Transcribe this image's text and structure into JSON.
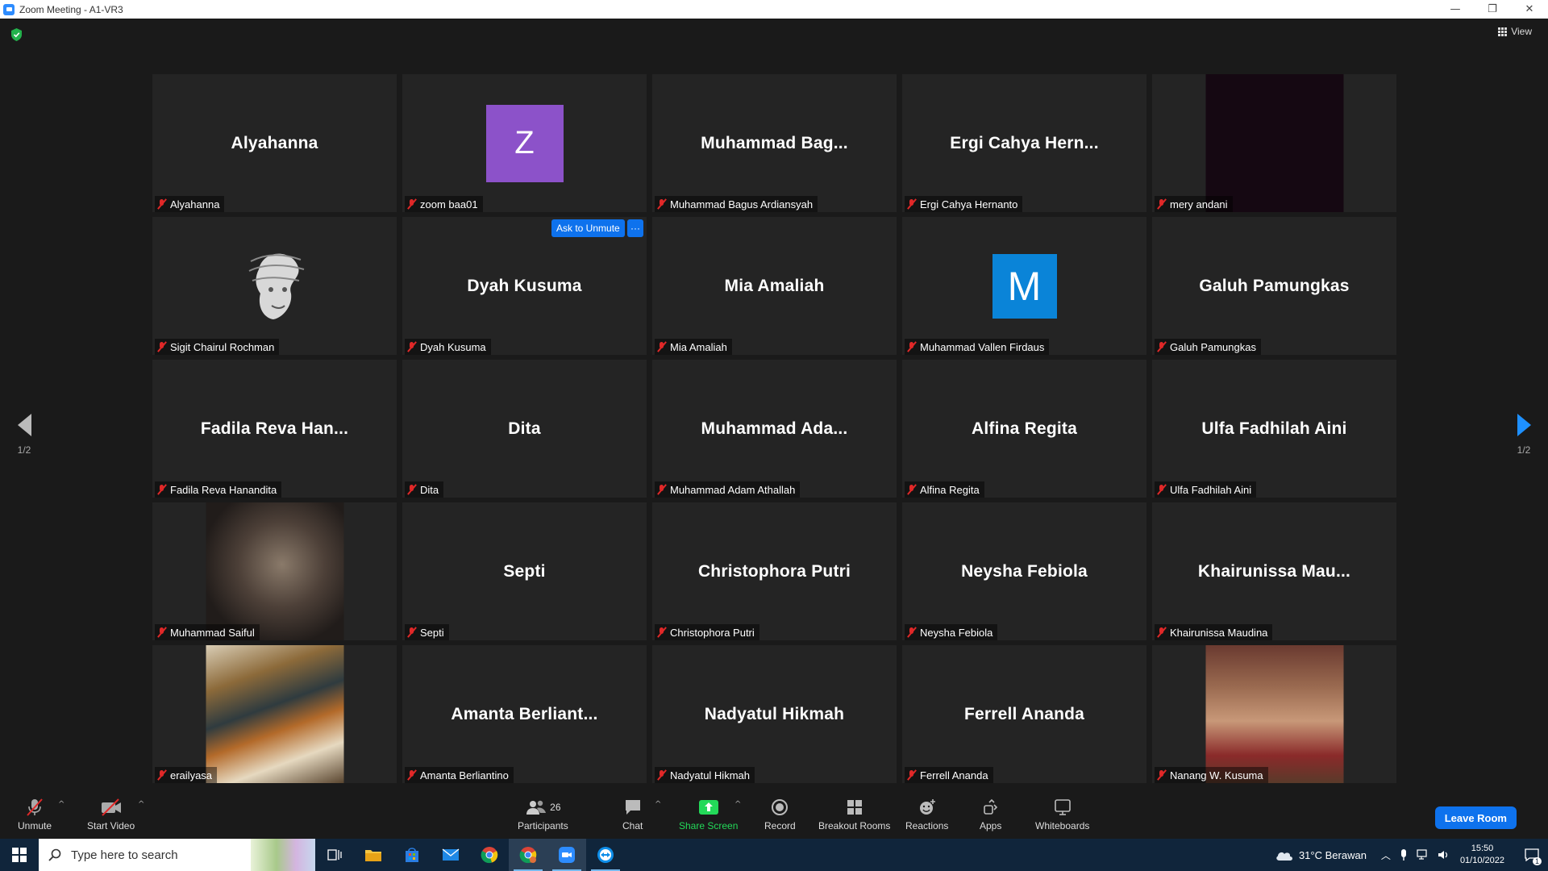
{
  "window": {
    "title": "Zoom Meeting - A1-VR3",
    "minimize": "—",
    "restore": "❐",
    "close": "✕"
  },
  "header": {
    "view_label": "View"
  },
  "tiles": [
    {
      "big": "Alyahanna",
      "label": "Alyahanna",
      "kind": "name"
    },
    {
      "big": "Z",
      "label": "zoom baa01",
      "kind": "letter",
      "color": "#8c52c9"
    },
    {
      "big": "Muhammad  Bag...",
      "label": "Muhammad Bagus Ardiansyah",
      "kind": "name"
    },
    {
      "big": "Ergi Cahya Hern...",
      "label": "Ergi Cahya Hernanto",
      "kind": "name"
    },
    {
      "big": "",
      "label": "mery andani",
      "kind": "dark-photo"
    },
    {
      "big": "",
      "label": "Sigit Chairul Rochman",
      "kind": "sketch"
    },
    {
      "big": "Dyah Kusuma",
      "label": "Dyah Kusuma",
      "kind": "name"
    },
    {
      "big": "Mia Amaliah",
      "label": "Mia Amaliah",
      "kind": "name"
    },
    {
      "big": "M",
      "label": "Muhammad Vallen Firdaus",
      "kind": "letter",
      "color": "#0a84d8"
    },
    {
      "big": "Galuh Pamungkas",
      "label": "Galuh Pamungkas",
      "kind": "name"
    },
    {
      "big": "Fadila Reva Han...",
      "label": "Fadila Reva Hanandita",
      "kind": "name"
    },
    {
      "big": "Dita",
      "label": "Dita",
      "kind": "name"
    },
    {
      "big": "Muhammad  Ada...",
      "label": "Muhammad Adam Athallah",
      "kind": "name"
    },
    {
      "big": "Alfina Regita",
      "label": "Alfina Regita",
      "kind": "name"
    },
    {
      "big": "Ulfa Fadhilah Aini",
      "label": "Ulfa Fadhilah Aini",
      "kind": "name"
    },
    {
      "big": "",
      "label": "Muhammad Saiful",
      "kind": "portrait-photo"
    },
    {
      "big": "Septi",
      "label": "Septi",
      "kind": "name"
    },
    {
      "big": "Christophora Putri",
      "label": "Christophora Putri",
      "kind": "name"
    },
    {
      "big": "Neysha Febiola",
      "label": "Neysha Febiola",
      "kind": "name"
    },
    {
      "big": "Khairunissa  Mau...",
      "label": "Khairunissa Maudina",
      "kind": "name"
    },
    {
      "big": "",
      "label": "erailyasa",
      "kind": "art-photo"
    },
    {
      "big": "Amanta  Berliant...",
      "label": "Amanta Berliantino",
      "kind": "name"
    },
    {
      "big": "Nadyatul Hikmah",
      "label": "Nadyatul Hikmah",
      "kind": "name"
    },
    {
      "big": "Ferrell Ananda",
      "label": "Ferrell Ananda",
      "kind": "name"
    },
    {
      "big": "",
      "label": "Nanang W. Kusuma",
      "kind": "man-photo"
    }
  ],
  "hover": {
    "ask_unmute": "Ask to Unmute",
    "more": "···"
  },
  "pager": {
    "left": "1/2",
    "right": "1/2"
  },
  "toolbar": {
    "unmute": "Unmute",
    "start_video": "Start Video",
    "participants": "Participants",
    "participants_count": "26",
    "chat": "Chat",
    "share_screen": "Share Screen",
    "record": "Record",
    "breakout_rooms": "Breakout Rooms",
    "reactions": "Reactions",
    "apps": "Apps",
    "whiteboards": "Whiteboards",
    "leave_room": "Leave Room",
    "caret": "^"
  },
  "taskbar": {
    "search_placeholder": "Type here to search",
    "weather": "31°C  Berawan",
    "time": "15:50",
    "date": "01/10/2022",
    "notif_count": "1"
  },
  "colors": {
    "accent": "#0e72ed",
    "share_green": "#23d959",
    "muted_red": "#e02828"
  }
}
